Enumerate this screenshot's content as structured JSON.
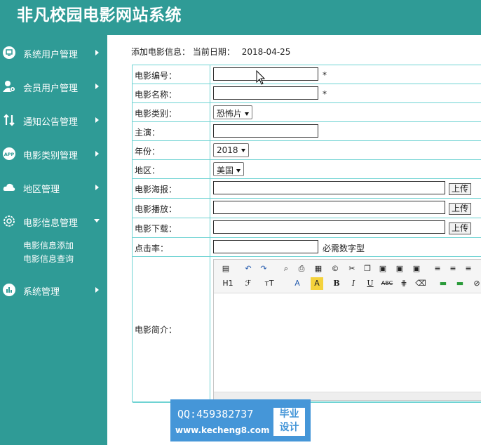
{
  "header": {
    "title": "非凡校园电影网站系统"
  },
  "sidebar": {
    "items": [
      {
        "label": "系统用户管理",
        "icon": "monitor-icon"
      },
      {
        "label": "会员用户管理",
        "icon": "user-gear-icon"
      },
      {
        "label": "通知公告管理",
        "icon": "swap-icon"
      },
      {
        "label": "电影类别管理",
        "icon": "app-icon"
      },
      {
        "label": "地区管理",
        "icon": "cloud-icon"
      },
      {
        "label": "电影信息管理",
        "icon": "gear-icon"
      },
      {
        "label": "系统管理",
        "icon": "bar-chart-icon"
      }
    ],
    "subitems": [
      "电影信息添加",
      "电影信息查询"
    ]
  },
  "breadcrumb": {
    "text": "添加电影信息：",
    "date_label": "当前日期：",
    "date": "2018-04-25"
  },
  "form": {
    "fields": {
      "movie_no": {
        "label": "电影编号：",
        "value": "",
        "required": "*"
      },
      "movie_name": {
        "label": "电影名称：",
        "value": "",
        "required": "*"
      },
      "category": {
        "label": "电影类别：",
        "selected": "恐怖片"
      },
      "actor": {
        "label": "主演：",
        "value": ""
      },
      "year": {
        "label": "年份：",
        "selected": "2018"
      },
      "region": {
        "label": "地区：",
        "selected": "美国"
      },
      "poster": {
        "label": "电影海报：",
        "value": "",
        "upload": "上传"
      },
      "play": {
        "label": "电影播放：",
        "value": "",
        "upload": "上传"
      },
      "download": {
        "label": "电影下载：",
        "value": "",
        "upload": "上传"
      },
      "clicks": {
        "label": "点击率：",
        "value": "",
        "hint": "必需数字型"
      },
      "intro": {
        "label": "电影简介："
      }
    }
  },
  "editor_toolbar": {
    "row1": [
      "source-icon",
      "undo-icon",
      "redo-icon",
      "preview-icon",
      "print-icon",
      "template-icon",
      "code-icon",
      "cut-icon",
      "copy-icon",
      "paste-icon",
      "paste-text-icon",
      "paste-word-icon",
      "align-left-icon",
      "align-center-icon",
      "align-right-icon"
    ],
    "row2_labels": {
      "heading": "H1",
      "font_family": "ℱ",
      "font_size": "тT",
      "font_color": "A",
      "highlight": "A",
      "bold": "B",
      "italic": "I",
      "underline": "U",
      "strikethrough": "ABC"
    }
  },
  "watermark": {
    "qq": "QQ:459382737",
    "url": "www.kecheng8.com",
    "badge_line1": "毕业",
    "badge_line2": "设计"
  },
  "colors": {
    "teal": "#2f9b96",
    "border": "#6fd3d3",
    "watermark_blue": "#4596d8"
  }
}
